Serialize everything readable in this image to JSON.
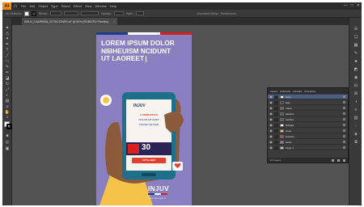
{
  "app": {
    "logo": "Ai"
  },
  "menu": [
    "File",
    "Edit",
    "Object",
    "Type",
    "Select",
    "Effect",
    "View",
    "Window",
    "Help"
  ],
  "window_controls": {
    "minimize": "—",
    "maximize": "□",
    "close": "✕"
  },
  "document_tab": {
    "title": "INJUV_CAMPAÑA_VOTACIONES.ai* @ 50% (RGB/GPU Preview)",
    "close": "×"
  },
  "control_bar": {
    "selection": "No Selection",
    "stroke_label": "Stroke:",
    "style_label": "Style:",
    "opacity_label": "Opacity:",
    "document_setup": "Document Setup",
    "preferences": "Preferences"
  },
  "artboard": {
    "headline": [
      "LOREM IPSUM DOLOR",
      "NIBHEUISM NCIDUNT",
      "UT LAOREET"
    ],
    "brand": "INJUV",
    "url": "www.injuv.gob.cl"
  },
  "phone_screen": {
    "brand": "INJUV",
    "line1": "LOREM IPSUM",
    "line2": "DOLOR SIT AMET",
    "line3": "CONSECTETUER",
    "number": "30",
    "button": "VOTA AQUÍ"
  },
  "layers_panel": {
    "tabs": [
      "Layers",
      "Artboards",
      "Libraries",
      "Properties"
    ],
    "rows": [
      "texto",
      "logo",
      "mano",
      "telefono",
      "sombra",
      "burbuja",
      "icono",
      "corazon",
      "fondo",
      "Layer 1"
    ],
    "count": "10 Layers"
  },
  "colors": {
    "flag_blue": "#1e3c8c",
    "flag_white": "#ffffff",
    "flag_red": "#d5221e",
    "artboard_bg": "#8a7fc0",
    "phone": "#1d6f8a",
    "skin": "#8a5a3a",
    "sleeve": "#f5c24a",
    "accent": "#e04030"
  },
  "icons": {
    "home": "home-icon",
    "selection": "selection-tool-icon",
    "heart": "heart-icon",
    "chat": "chat-bubble-icon",
    "eye": "eye-icon"
  }
}
